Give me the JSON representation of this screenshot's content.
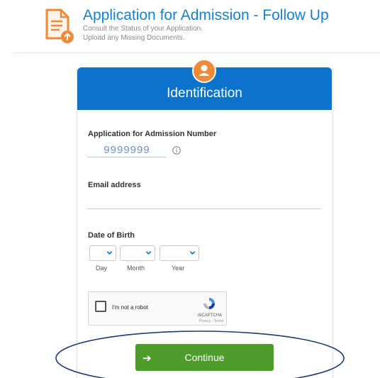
{
  "header": {
    "title": "Application for Admission - Follow Up",
    "subtitle_line1": "Consult the Status of your Application.",
    "subtitle_line2": "Upload any Missing Documents.",
    "icon": "document-upload-icon"
  },
  "card": {
    "title": "Identification",
    "avatar_icon": "user-icon"
  },
  "form": {
    "application_label": "Application for Admission Number",
    "application_value": "9999999",
    "email_label": "Email address",
    "email_value": "",
    "dob_label": "Date of Birth",
    "day_label": "Day",
    "month_label": "Month",
    "year_label": "Year"
  },
  "captcha": {
    "label": "I'm not a robot",
    "brand": "reCAPTCHA",
    "small": "Privacy - Terms"
  },
  "continue_button": {
    "label": "Continue",
    "arrow": "➔"
  },
  "colors": {
    "brand_blue": "#0b73c9",
    "title_blue": "#1b7fcf",
    "accent_orange": "#ef8a3a",
    "button_green": "#4e9d2a"
  }
}
